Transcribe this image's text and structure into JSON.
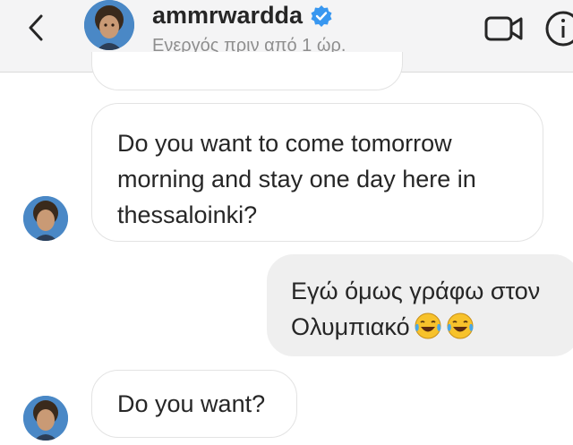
{
  "header": {
    "username": "ammrwardda",
    "status": "Ενεργός πριν από 1 ώρ.",
    "verified": true,
    "icons": [
      "back-arrow-icon",
      "verified-badge-icon",
      "video-call-icon",
      "info-icon"
    ]
  },
  "messages": [
    {
      "sender": "ammrwardda",
      "text": "Do you want to come tomorrow morning and stay one day here in thessaloinki?"
    },
    {
      "sender": "me",
      "text": "Εγώ όμως γράφω στον Ολυμπιακό",
      "emojis": [
        "tears-of-joy-emoji",
        "tears-of-joy-emoji"
      ]
    },
    {
      "sender": "ammrwardda",
      "text": "Do you want?"
    }
  ],
  "colors": {
    "accent_verified": "#3897f0",
    "incoming_bubble_border": "#e3e3e3",
    "outgoing_bubble": "#efefef",
    "secondary_text": "#8e8e8e"
  }
}
